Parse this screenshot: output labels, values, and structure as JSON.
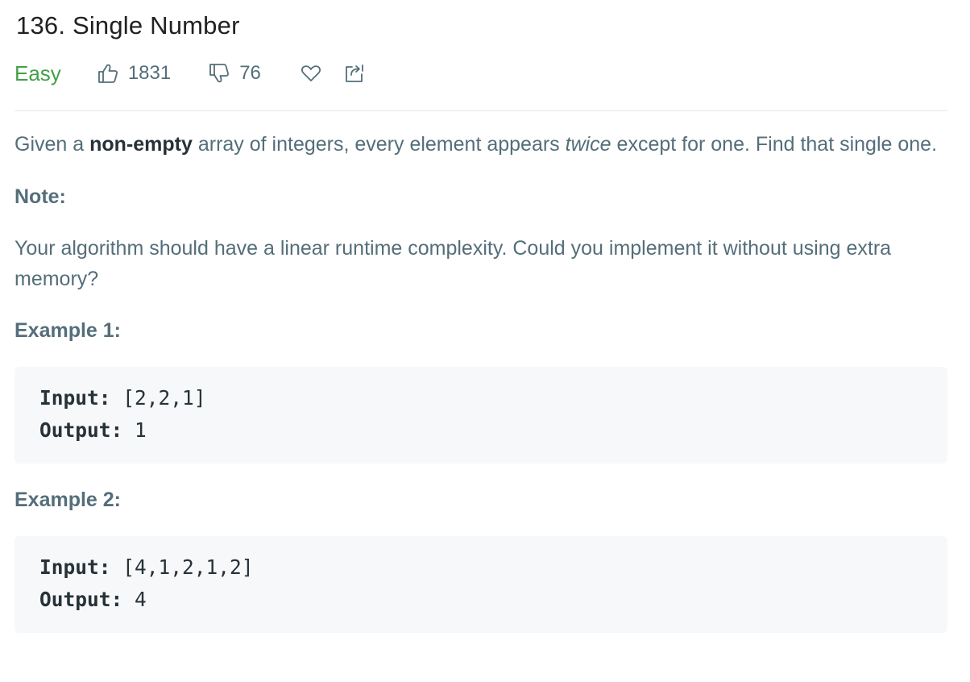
{
  "problem": {
    "title": "136. Single Number",
    "difficulty": "Easy",
    "likes": "1831",
    "dislikes": "76"
  },
  "colors": {
    "difficulty_easy": "#43a047",
    "text_secondary": "#546e7a",
    "code_background": "#f7f8fa"
  },
  "icons": {
    "like": "thumbs-up-icon",
    "dislike": "thumbs-down-icon",
    "favorite": "heart-icon",
    "share": "share-icon"
  },
  "description": {
    "intro_pre": "Given a ",
    "intro_bold": "non-empty",
    "intro_mid": " array of integers, every element appears ",
    "intro_italic": "twice",
    "intro_post": " except for one. Find that single one.",
    "note_label": "Note:",
    "note_text": "Your algorithm should have a linear runtime complexity. Could you implement it without using extra memory?"
  },
  "examples": [
    {
      "label": "Example 1:",
      "input_label": "Input:",
      "input_value": " [2,2,1]",
      "output_label": "Output:",
      "output_value": " 1"
    },
    {
      "label": "Example 2:",
      "input_label": "Input:",
      "input_value": " [4,1,2,1,2]",
      "output_label": "Output:",
      "output_value": " 4"
    }
  ]
}
